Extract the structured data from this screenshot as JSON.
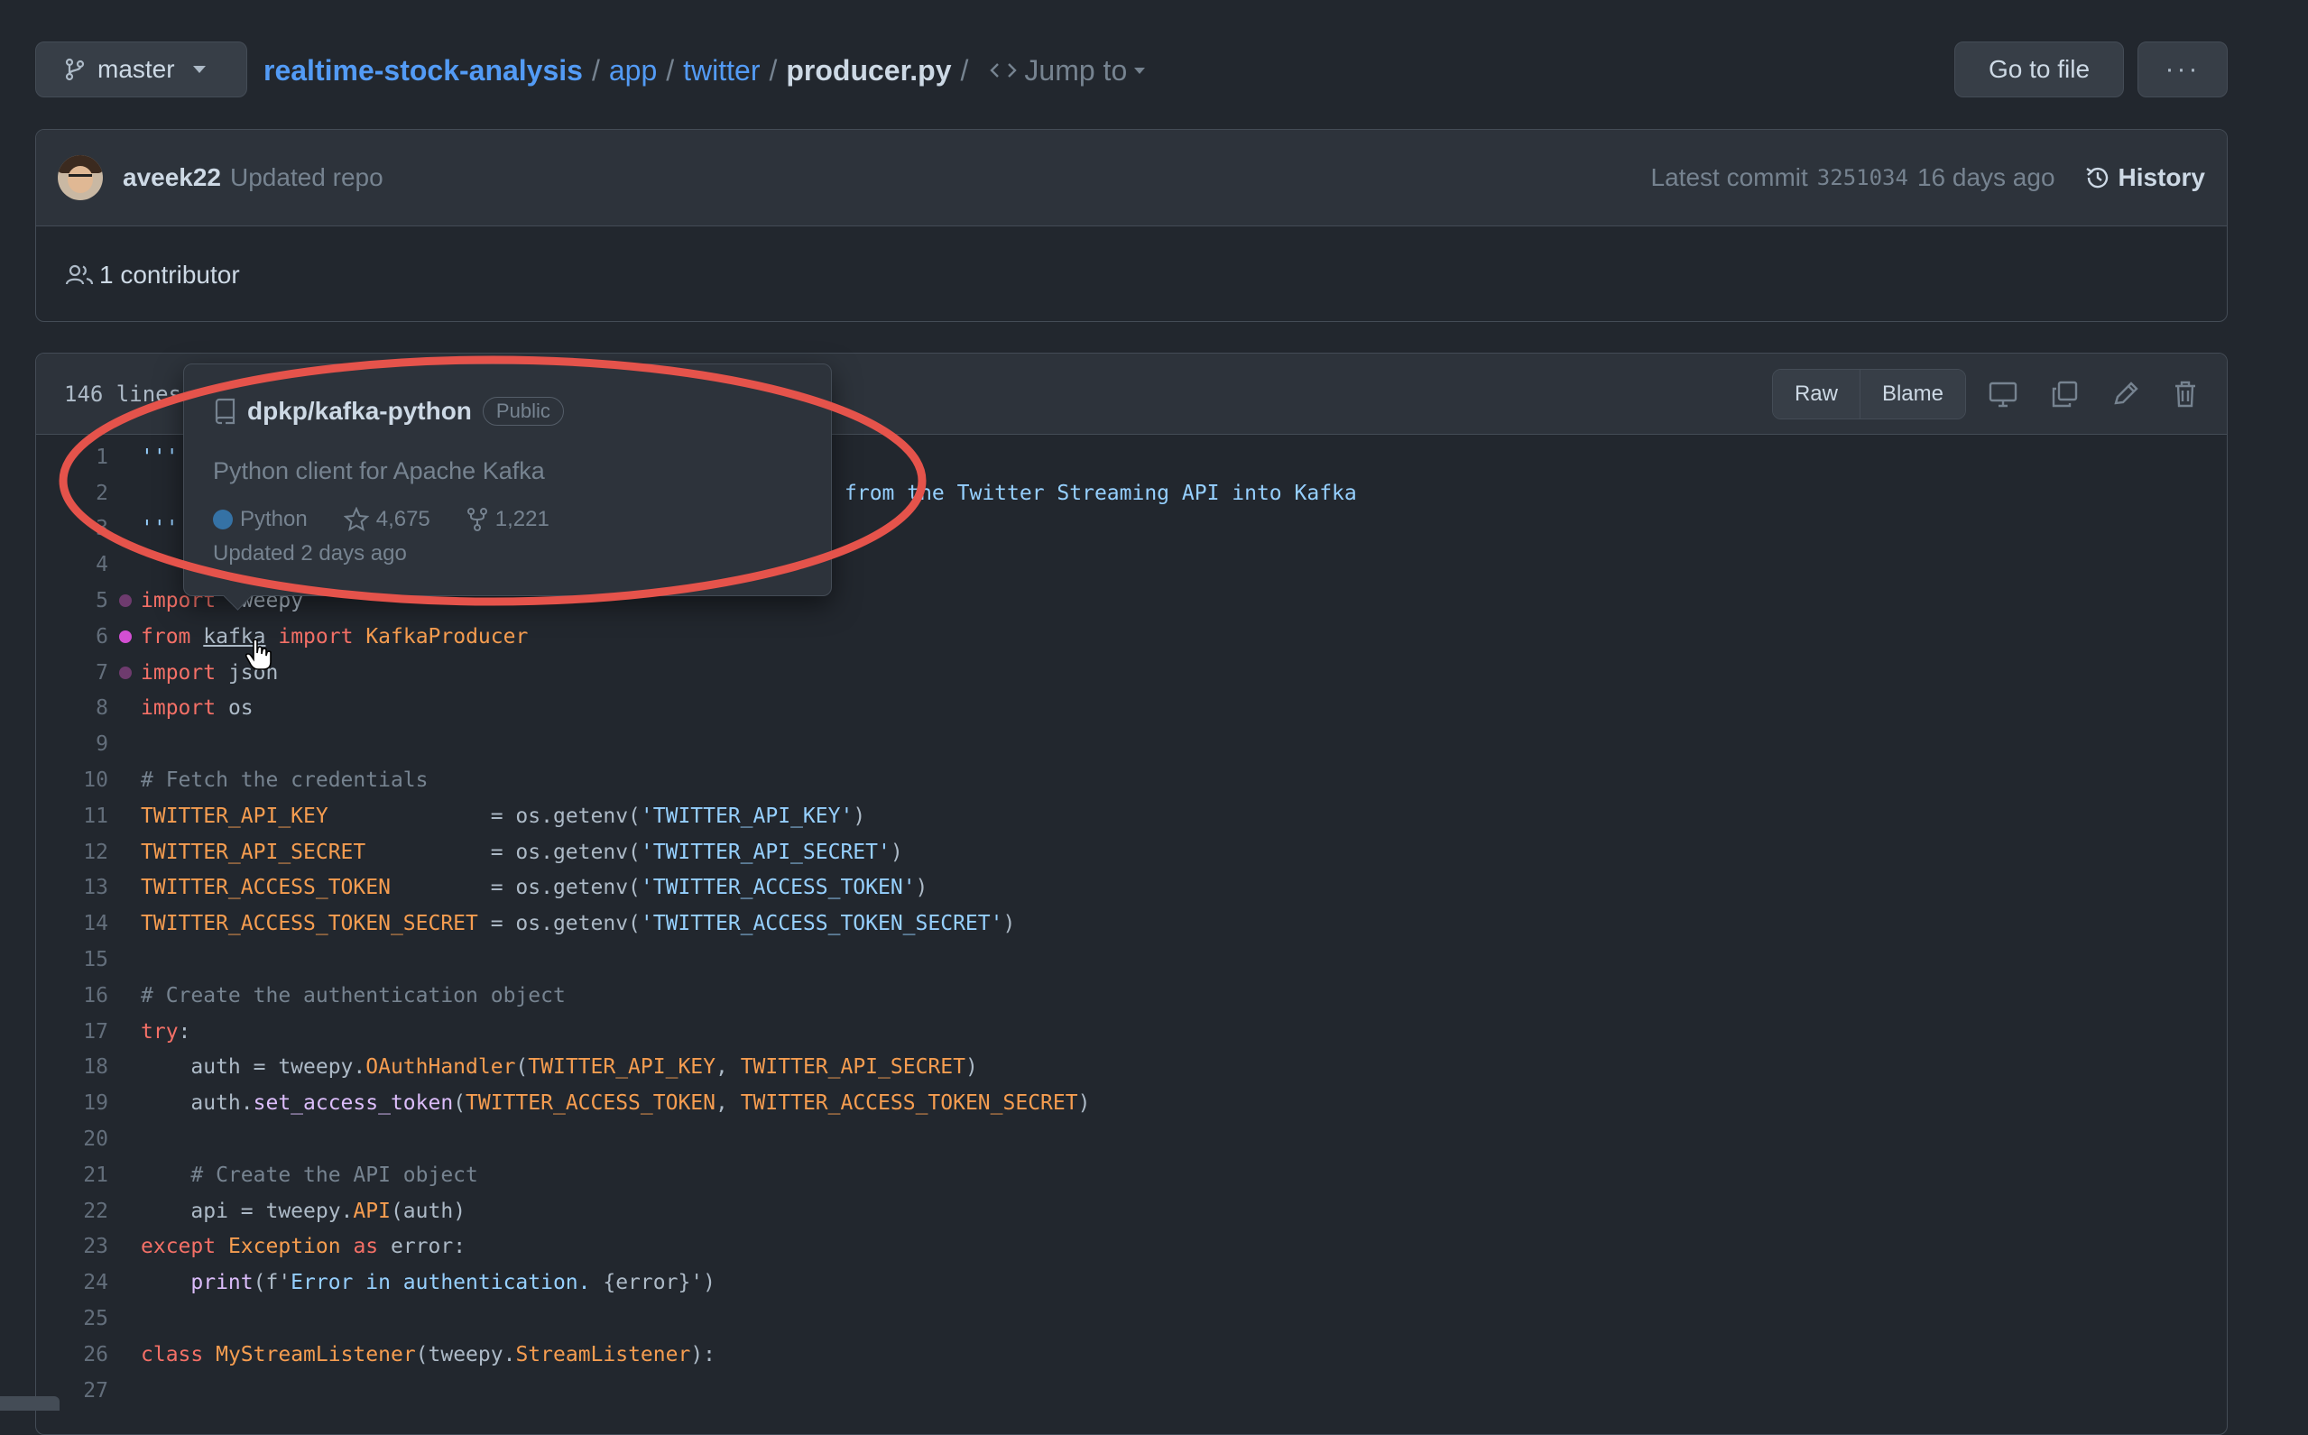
{
  "header": {
    "branch": "master",
    "breadcrumb": {
      "repo": "realtime-stock-analysis",
      "dir1": "app",
      "dir2": "twitter",
      "file": "producer.py",
      "jump": "Jump to"
    },
    "goto_file": "Go to file",
    "more": "···"
  },
  "commit": {
    "author": "aveek22",
    "message": "Updated repo",
    "latest_label": "Latest commit",
    "sha": "3251034",
    "age": "16 days ago",
    "history": "History",
    "contributors": "1 contributor"
  },
  "file": {
    "lines_label": "146 lines",
    "raw": "Raw",
    "blame": "Blame"
  },
  "hovercard": {
    "repo": "dpkp/kafka-python",
    "visibility": "Public",
    "description": "Python client for Apache Kafka",
    "language": "Python",
    "stars": "4,675",
    "forks": "1,221",
    "updated": "Updated 2 days ago"
  },
  "colors": {
    "accent": "#539bf5",
    "annotation_red": "#e5534b",
    "dot_active": "#d34fd3",
    "dot_inactive": "#6e3b6e"
  },
  "code": {
    "line1": "'''",
    "line2_visible": "from the Twitter Streaming API into Kafka",
    "line3": "'''",
    "line5_kw": "import",
    "line5_rest": "tweepy",
    "line6_from": "from",
    "line6_mod": "kafka",
    "line6_import": "import",
    "line6_cls": "KafkaProducer",
    "line7_kw": "import",
    "line7_rest": "json",
    "line8_kw": "import",
    "line8_rest": "os",
    "line10": "# Fetch the credentials",
    "line11_var": "TWITTER_API_KEY",
    "line11_pad": "             = os.getenv(",
    "line11_str": "'TWITTER_API_KEY'",
    "line12_var": "TWITTER_API_SECRET",
    "line12_pad": "          = os.getenv(",
    "line12_str": "'TWITTER_API_SECRET'",
    "line13_var": "TWITTER_ACCESS_TOKEN",
    "line13_pad": "        = os.getenv(",
    "line13_str": "'TWITTER_ACCESS_TOKEN'",
    "line14_var": "TWITTER_ACCESS_TOKEN_SECRET",
    "line14_pad": " = os.getenv(",
    "line14_str": "'TWITTER_ACCESS_TOKEN_SECRET'",
    "line16": "# Create the authentication object",
    "line17": "try",
    "line18_a": "    auth = tweepy.",
    "line18_fn": "OAuthHandler",
    "line18_v1": "TWITTER_API_KEY",
    "line18_v2": "TWITTER_API_SECRET",
    "line19_a": "    auth.",
    "line19_fn": "set_access_token",
    "line19_v1": "TWITTER_ACCESS_TOKEN",
    "line19_v2": "TWITTER_ACCESS_TOKEN_SECRET",
    "line21": "    # Create the API object",
    "line22_a": "    api = tweepy.",
    "line22_fn": "API",
    "line22_b": "(auth)",
    "line23_kw": "except",
    "line23_cls": "Exception",
    "line23_as": "as",
    "line23_rest": " error:",
    "line24_fn": "    print",
    "line24_a": "(f'",
    "line24_str": "Error in authentication.",
    "line24_b": " {error}')",
    "line26_kw": "class",
    "line26_cls": "MyStreamListener",
    "line26_a": "(tweepy.",
    "line26_base": "StreamListener",
    "line26_b": "):"
  },
  "line_numbers": [
    "1",
    "2",
    "3",
    "4",
    "5",
    "6",
    "7",
    "8",
    "9",
    "10",
    "11",
    "12",
    "13",
    "14",
    "15",
    "16",
    "17",
    "18",
    "19",
    "20",
    "21",
    "22",
    "23",
    "24",
    "25",
    "26",
    "27"
  ]
}
